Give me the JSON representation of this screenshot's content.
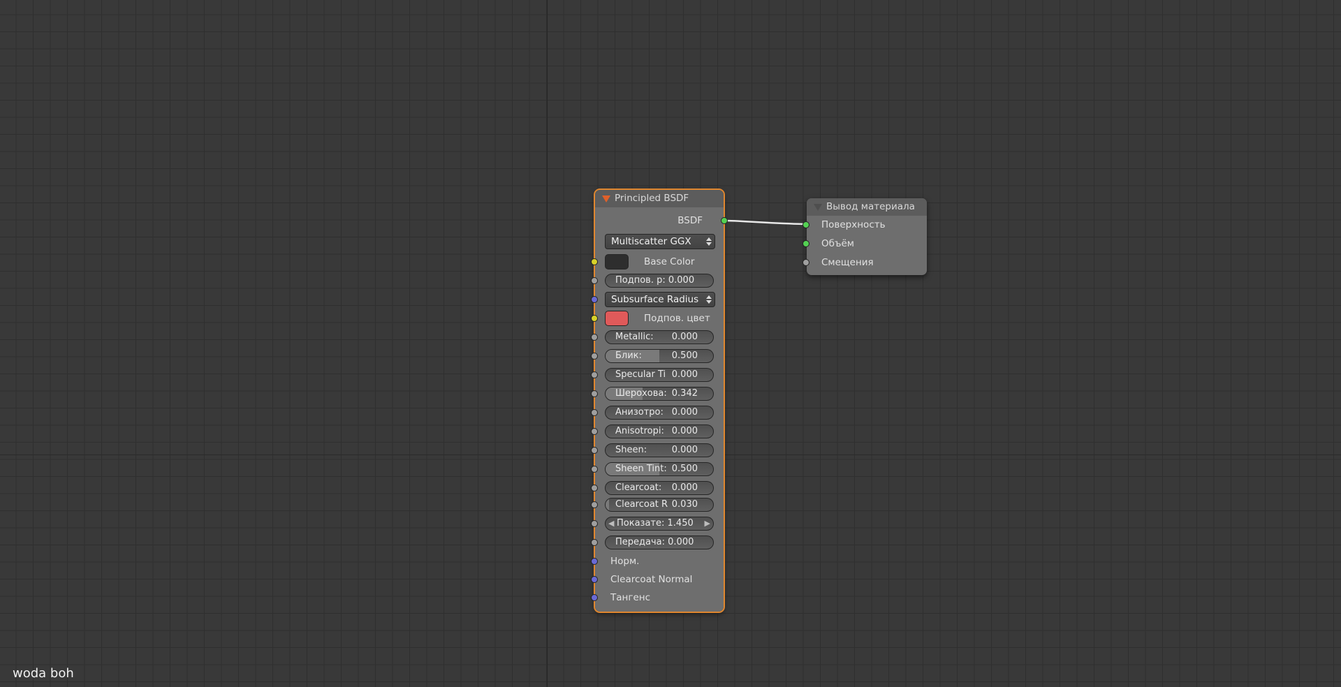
{
  "editor": {
    "footer_label": "woda boh"
  },
  "principled_node": {
    "title": "Principled BSDF",
    "output_label": "BSDF",
    "distribution": "Multiscatter GGX",
    "base_color": {
      "label": "Base Color",
      "color": "#2e2e2e"
    },
    "subsurface": {
      "label": "Подпов. р:",
      "value": "0.000"
    },
    "subsurface_method": "Subsurface Radius",
    "subsurface_color": {
      "label": "Подпов. цвет",
      "color": "#e05a5a"
    },
    "metallic": {
      "label": "Metallic:",
      "value": "0.000",
      "fraction": 0.0
    },
    "specular": {
      "label": "Блик:",
      "value": "0.500",
      "fraction": 0.5
    },
    "specular_tint": {
      "label": "Specular Ti",
      "value": "0.000",
      "fraction": 0.0
    },
    "roughness": {
      "label": "Шерохова:",
      "value": "0.342",
      "fraction": 0.342
    },
    "anisotropic": {
      "label": "Анизотро:",
      "value": "0.000",
      "fraction": 0.0
    },
    "anisotropic_rotation": {
      "label": "Anisotropi:",
      "value": "0.000",
      "fraction": 0.0
    },
    "sheen": {
      "label": "Sheen:",
      "value": "0.000",
      "fraction": 0.0
    },
    "sheen_tint": {
      "label": "Sheen Tint:",
      "value": "0.500",
      "fraction": 0.5
    },
    "clearcoat": {
      "label": "Clearcoat:",
      "value": "0.000",
      "fraction": 0.0
    },
    "clearcoat_roughness": {
      "label": "Clearcoat R",
      "value": "0.030",
      "fraction": 0.03
    },
    "ior": {
      "label": "Показате:",
      "value": "1.450"
    },
    "transmission": {
      "label": "Передача:",
      "value": "0.000",
      "fraction": 0.0
    },
    "normal_label": "Норм.",
    "clearcoat_normal_label": "Clearcoat Normal",
    "tangent_label": "Тангенс"
  },
  "output_node": {
    "title": "Вывод материала",
    "surface_label": "Поверхность",
    "volume_label": "Объём",
    "displacement_label": "Смещения"
  },
  "colors": {
    "selection_outline": "#e0872f",
    "socket_shader": "#54d153",
    "socket_color": "#d7d22a",
    "socket_value": "#9f9f9f",
    "socket_vector": "#6a6ad6"
  }
}
